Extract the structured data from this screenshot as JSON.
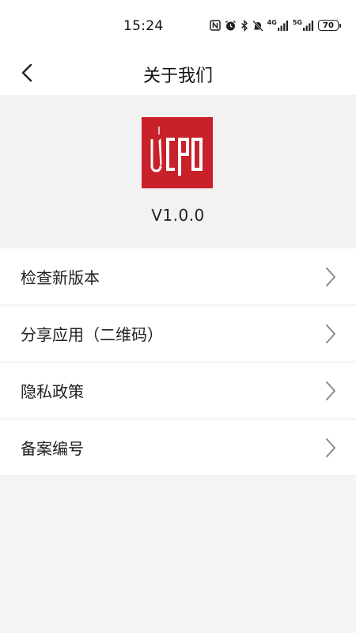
{
  "status_bar": {
    "time": "15:24",
    "network_4g": "4G",
    "network_5g": "5G",
    "battery_level": "70",
    "icons": [
      "nfc-icon",
      "alarm-icon",
      "bluetooth-icon",
      "mute-icon",
      "signal-4g-icon",
      "signal-5g-icon",
      "battery-icon"
    ]
  },
  "top_bar": {
    "back_icon": "back-arrow-icon",
    "title": "关于我们"
  },
  "about": {
    "logo_text": "UCPD",
    "logo_color": "#c8212a",
    "version": "V1.0.0"
  },
  "menu": {
    "items": [
      {
        "label": "检查新版本",
        "icon": "chevron-right-icon"
      },
      {
        "label": "分享应用（二维码）",
        "icon": "chevron-right-icon"
      },
      {
        "label": "隐私政策",
        "icon": "chevron-right-icon"
      },
      {
        "label": "备案编号",
        "icon": "chevron-right-icon"
      }
    ]
  }
}
